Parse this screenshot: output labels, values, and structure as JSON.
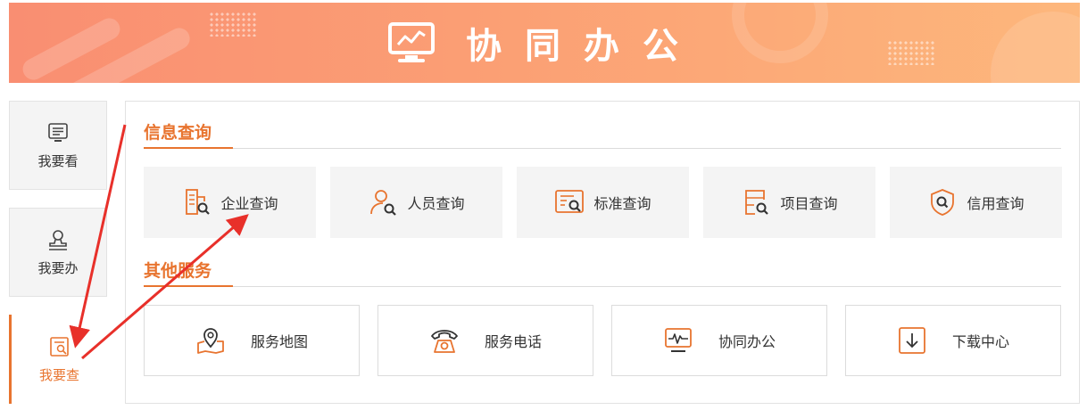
{
  "banner": {
    "title": "协同办公",
    "icon": "monitor-chart-icon"
  },
  "nav": [
    {
      "label": "我要看",
      "icon": "list-doc-icon",
      "active": false
    },
    {
      "label": "我要办",
      "icon": "stamp-icon",
      "active": false
    },
    {
      "label": "我要查",
      "icon": "search-doc-icon",
      "active": true
    }
  ],
  "sections": {
    "info_query": {
      "title": "信息查询",
      "items": [
        {
          "label": "企业查询",
          "icon": "building-search-icon"
        },
        {
          "label": "人员查询",
          "icon": "person-search-icon"
        },
        {
          "label": "标准查询",
          "icon": "document-search-icon"
        },
        {
          "label": "项目查询",
          "icon": "list-search-icon"
        },
        {
          "label": "信用查询",
          "icon": "shield-search-icon"
        }
      ]
    },
    "other_services": {
      "title": "其他服务",
      "items": [
        {
          "label": "服务地图",
          "icon": "map-pin-icon"
        },
        {
          "label": "服务电话",
          "icon": "telephone-icon"
        },
        {
          "label": "协同办公",
          "icon": "monitor-pulse-icon"
        },
        {
          "label": "下载中心",
          "icon": "download-icon"
        }
      ]
    }
  },
  "colors": {
    "accent": "#e8742f",
    "banner_start": "#f98e72",
    "banner_end": "#fdb77c",
    "annotation": "#e8302a"
  }
}
